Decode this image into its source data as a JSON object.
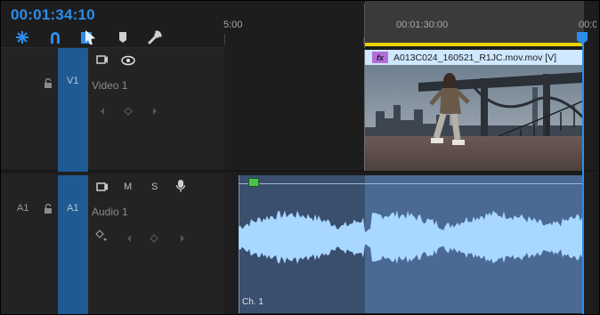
{
  "header": {
    "timecode": "00:01:34:10",
    "tools": [
      {
        "icon": "snap-icon"
      },
      {
        "icon": "linked-selection-icon"
      },
      {
        "icon": "selection-tool-icon"
      },
      {
        "icon": "add-marker-icon"
      },
      {
        "icon": "wrench-icon"
      }
    ]
  },
  "ruler": {
    "labels": [
      "5:00",
      "00:01:30:00",
      "00:0"
    ]
  },
  "tracks": {
    "video": {
      "target_label": "V1",
      "name": "Video 1"
    },
    "audio": {
      "source_label": "A1",
      "target_label": "A1",
      "name": "Audio 1",
      "mute_label": "M",
      "solo_label": "S"
    }
  },
  "clips": {
    "video": {
      "fx_label": "fx",
      "name": "A013C024_160521_R1JC.mov.mov [V]"
    },
    "audio": {
      "channel_label": "Ch. 1"
    }
  },
  "colors": {
    "accent": "#2d8ceb",
    "work_area": "#e8d200",
    "target_track": "#1f5a92",
    "audio_clip": "#3a4f6e",
    "waveform": "#a8d7ff"
  }
}
